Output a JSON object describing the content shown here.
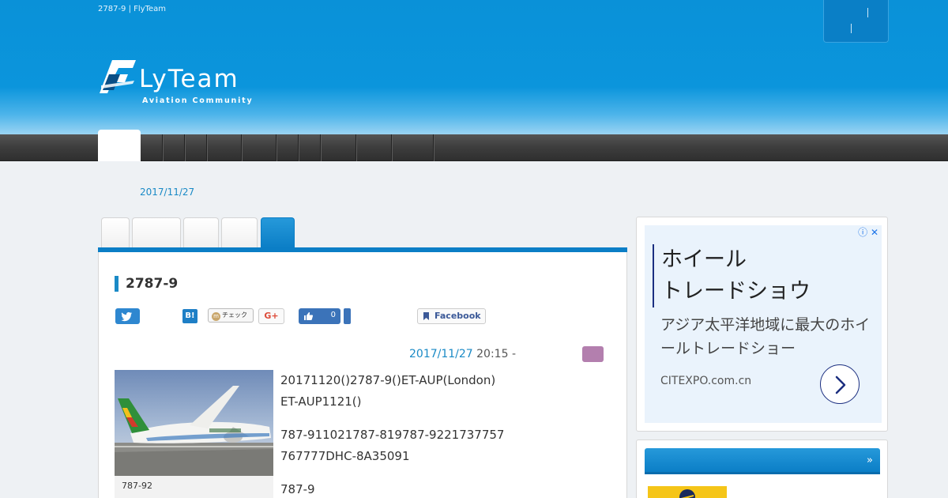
{
  "header": {
    "site_title": "2787-9 | FlyTeam",
    "logo_text": "LyTeam",
    "logo_sub": "Aviation Community"
  },
  "date_top": "2017/11/27",
  "article": {
    "title": "2787-9",
    "share": {
      "hatena": "B!",
      "mixi_mark": "m",
      "mixi_label": "チェック",
      "google_plus": "G+",
      "like_count": "0",
      "facebook": "Facebook"
    },
    "meta_date": "2017/11/27",
    "meta_time": " 20:15 -",
    "photo_caption": "787-92",
    "paragraphs": [
      "20171120()2787-9()ET-AUP(London)",
      "ET-AUP1121()",
      "787-911021787-819787-9221737757",
      "767777DHC-8A35091",
      "787-9"
    ]
  },
  "ad": {
    "close_icons": "ⓘ ✕",
    "headline_1": "ホイール",
    "headline_2": "トレードショウ",
    "desc": "アジア太平洋地域に最大のホイールトレードショー",
    "url": "CITEXPO.com.cn"
  },
  "widget": {
    "more": "»"
  },
  "colors": {
    "brand_blue": "#0b7ec6",
    "header_blue": "#0a91d8",
    "link": "#1a8ac6",
    "tag": "#b37fae"
  },
  "icons": [
    "twitter-icon",
    "like-icon",
    "bookmark-icon",
    "chevron-right-icon",
    "info-icon",
    "close-icon"
  ]
}
